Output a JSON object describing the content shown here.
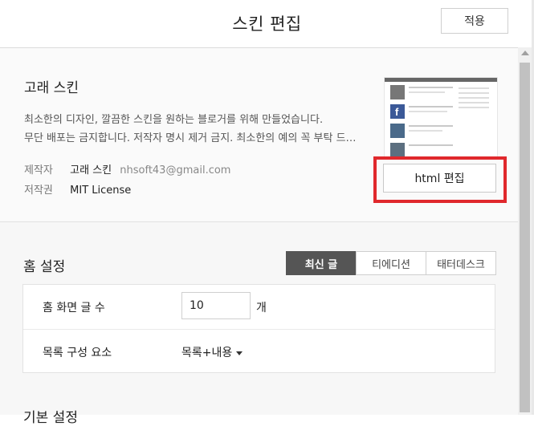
{
  "header": {
    "title": "스킨 편집",
    "apply_label": "적용"
  },
  "skin": {
    "name": "고래 스킨",
    "description_lines": [
      "최소한의 디자인, 깔끔한 스킨을 원하는 블로거를 위해 만들었습니다.",
      "무단 배포는 금지합니다. 저작자 명시 제거 금지. 최소한의 예의 꼭 부탁 드…"
    ],
    "author_label": "제작자",
    "author_name": "고래 스킨",
    "author_email": "nhsoft43@gmail.com",
    "license_label": "저작권",
    "license_value": "MIT License",
    "html_edit_label": "html 편집",
    "highlight_color": "#e0282c"
  },
  "home": {
    "title": "홈 설정",
    "tabs": [
      {
        "label": "최신 글",
        "active": true
      },
      {
        "label": "티에디션",
        "active": false
      },
      {
        "label": "태터데스크",
        "active": false
      }
    ],
    "post_count_label": "홈 화면 글 수",
    "post_count_value": "10",
    "post_count_unit": "개",
    "list_layout_label": "목록 구성 요소",
    "list_layout_value": "목록+내용"
  },
  "basic": {
    "title": "기본 설정"
  }
}
